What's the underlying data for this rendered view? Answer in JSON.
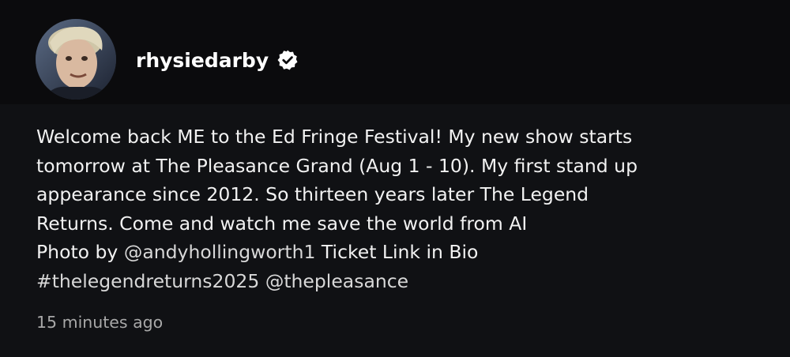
{
  "post": {
    "username": "rhysiedarby",
    "verified": true,
    "caption": {
      "line1": "Welcome back ME to the Ed Fringe Festival! My new show starts",
      "line2": "tomorrow at The Pleasance Grand (Aug 1 - 10). My first stand up",
      "line3": "appearance since 2012. So thirteen years later The Legend",
      "line4": "Returns. Come and watch me save the world from AI",
      "photo_by": "Photo by",
      "mention_photographer": "andyhollingworth1",
      "ticket_text": "Ticket Link in Bio",
      "hashtag": "#thelegendreturns2025",
      "mention_venue": "thepleasance"
    },
    "timestamp": "15 minutes ago"
  },
  "icons": {
    "avatar": "profile-photo",
    "verified": "verified-badge-icon",
    "mention": "threads-at-icon"
  },
  "colors": {
    "background": "#101114",
    "header_background": "#0b0b0d",
    "text": "#f2f2f2",
    "muted_text": "#a8a8a8"
  }
}
